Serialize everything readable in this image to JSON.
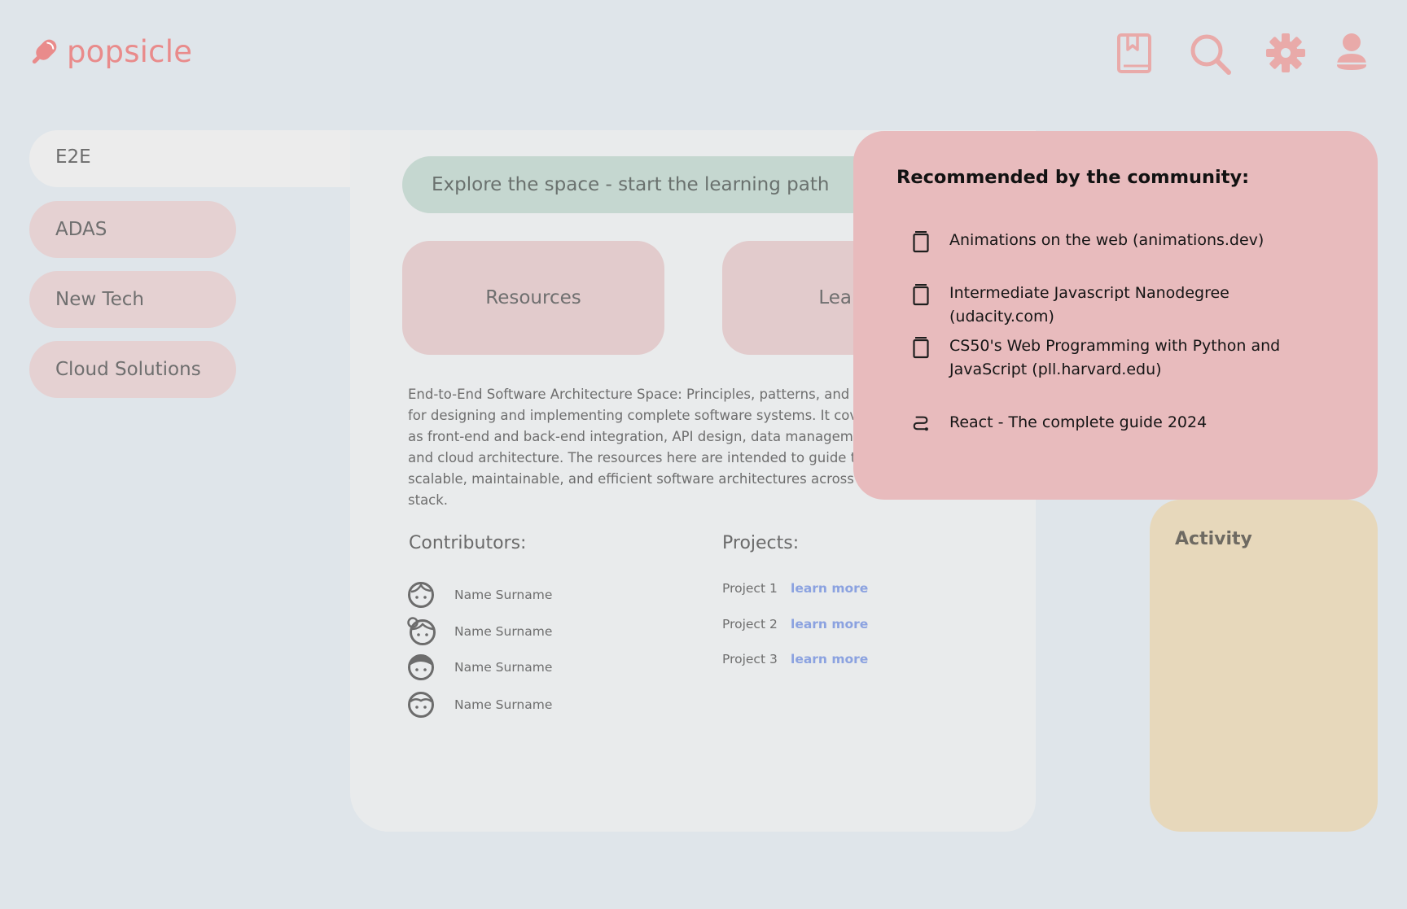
{
  "brand": {
    "name": "popsicle",
    "logo_icon": "popsicle-icon",
    "color": "#e98b8b"
  },
  "header_icons": [
    "book-icon",
    "search-icon",
    "gear-icon",
    "user-icon"
  ],
  "sidebar": {
    "active": "E2E",
    "items": [
      "ADAS",
      "New Tech",
      "Cloud Solutions"
    ]
  },
  "main": {
    "explore_label": "Explore the space - start the learning path",
    "cards": [
      "Resources",
      "Learnin"
    ],
    "description": "End-to-End Software Architecture Space: Principles, patterns, and p\nfor designing and implementing complete software systems. It cover\nas front-end and back-end integration, API design, data managemen\nand cloud architecture. The resources here are intended to guide th\nscalable, maintainable, and efficient software architectures across th\nstack.",
    "contributors_title": "Contributors:",
    "contributors": [
      "Name Surname",
      "Name Surname",
      "Name Surname",
      "Name Surname"
    ],
    "projects_title": "Projects:",
    "projects": [
      {
        "name": "Project 1",
        "link": "learn more"
      },
      {
        "name": "Project 2",
        "link": "learn more"
      },
      {
        "name": "Project 3",
        "link": "learn more"
      }
    ]
  },
  "recommended": {
    "title": "Recommended by the community:",
    "items": [
      {
        "icon": "book-icon",
        "text": "Animations on the web (animations.dev)"
      },
      {
        "icon": "book-icon",
        "text": "Intermediate Javascript Nanodegree (udacity.com)"
      },
      {
        "icon": "book-icon",
        "text": "CS50's Web Programming with Python and JavaScript (pll.harvard.edu)"
      },
      {
        "icon": "route-icon",
        "text": "React - The complete guide 2024"
      }
    ]
  },
  "activity": {
    "title": "Activity"
  }
}
